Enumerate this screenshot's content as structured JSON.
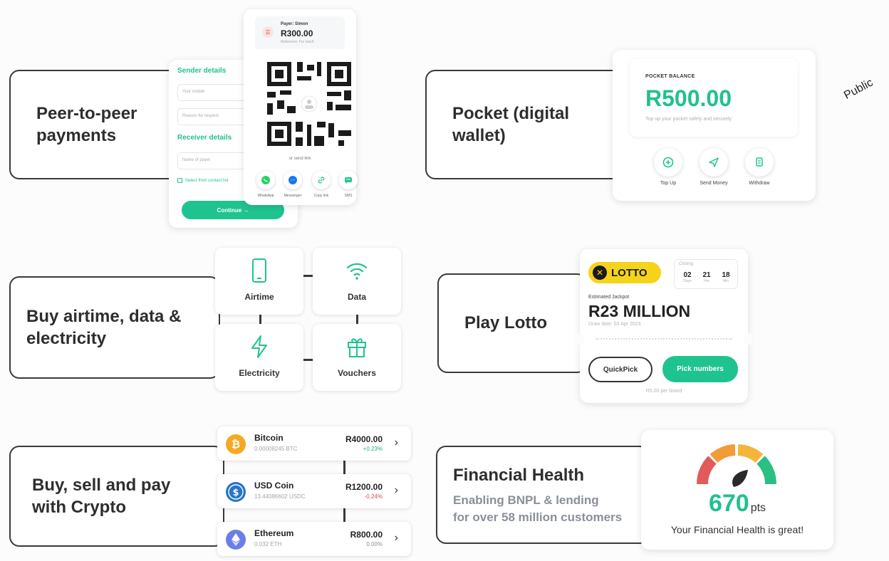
{
  "watermark": "Public",
  "features": {
    "p2p": {
      "title": "Peer-to-peer\npayments"
    },
    "pocket": {
      "title": "Pocket (digital\nwallet)"
    },
    "buy": {
      "title": "Buy airtime, data &\nelectricity"
    },
    "lotto": {
      "title": "Play Lotto"
    },
    "crypto": {
      "title": "Buy, sell and pay\nwith Crypto"
    },
    "health": {
      "title": "Financial Health",
      "subtitle": "Enabling BNPL & lending\nfor over 58 million customers"
    }
  },
  "p2p_card": {
    "sender_heading": "Sender details",
    "your_mobile_placeholder": "Your mobile",
    "reason_placeholder": "Reason for request",
    "receiver_heading": "Receiver details",
    "payer_name_placeholder": "Name of payer",
    "contact_list_label": "Select from contact list",
    "continue_label": "Continue →",
    "payer_label": "Payer: Simon",
    "amount": "R300.00",
    "reference": "Reference: For lunch",
    "qr_caption": "or send link",
    "share": [
      {
        "label": "WhatsApp",
        "icon": "whatsapp-icon",
        "color": "#25D366"
      },
      {
        "label": "Messenger",
        "icon": "messenger-icon",
        "color": "#1877F2"
      },
      {
        "label": "Copy link",
        "icon": "link-icon",
        "color": "#1fc390"
      },
      {
        "label": "SMS",
        "icon": "sms-icon",
        "color": "#1fc390"
      }
    ]
  },
  "pocket_card": {
    "balance_label": "POCKET BALANCE",
    "balance": "R500.00",
    "helper_text": "Top up your pocket safely and securely",
    "actions": [
      {
        "label": "Top Up",
        "icon": "plus-circle-icon"
      },
      {
        "label": "Send Money",
        "icon": "send-icon"
      },
      {
        "label": "Withdraw",
        "icon": "withdraw-icon"
      }
    ]
  },
  "tiles": [
    {
      "label": "Airtime",
      "icon": "phone-icon"
    },
    {
      "label": "Data",
      "icon": "wifi-icon"
    },
    {
      "label": "Electricity",
      "icon": "lightning-icon"
    },
    {
      "label": "Vouchers",
      "icon": "gift-icon"
    }
  ],
  "lotto_card": {
    "brand": "LOTTO",
    "closing_label": "Closing",
    "countdown": [
      {
        "value": "02",
        "unit": "Days"
      },
      {
        "value": "21",
        "unit": "Hrs"
      },
      {
        "value": "18",
        "unit": "Min"
      }
    ],
    "jackpot_label": "Estimated Jackpot",
    "jackpot": "R23 MILLION",
    "draw_date": "Draw date: 03 Apr 2023",
    "quickpick_label": "QuickPick",
    "pick_numbers_label": "Pick numbers",
    "price_note": "R5.00 per board"
  },
  "crypto": [
    {
      "name": "Bitcoin",
      "amount": "0.00008245 BTC",
      "price": "R4000.00",
      "change": "+0.23%",
      "change_color": "#22b07d",
      "icon": "bitcoin-icon",
      "color": "#f7a823"
    },
    {
      "name": "USD Coin",
      "amount": "13.44086602 USDC",
      "price": "R1200.00",
      "change": "-0.24%",
      "change_color": "#e14b4b",
      "icon": "usdc-icon",
      "color": "#2775ca"
    },
    {
      "name": "Ethereum",
      "amount": "0.032 ETH",
      "price": "R800.00",
      "change": "0.00%",
      "change_color": "#8a8f98",
      "icon": "ethereum-icon",
      "color": "#6b7ee8"
    }
  ],
  "health_card": {
    "score": "670",
    "unit": "pts",
    "message": "Your Financial Health is great!"
  },
  "colors": {
    "accent": "#1fc390",
    "text_dark": "#2e2e2e",
    "muted": "#8a8f98"
  }
}
